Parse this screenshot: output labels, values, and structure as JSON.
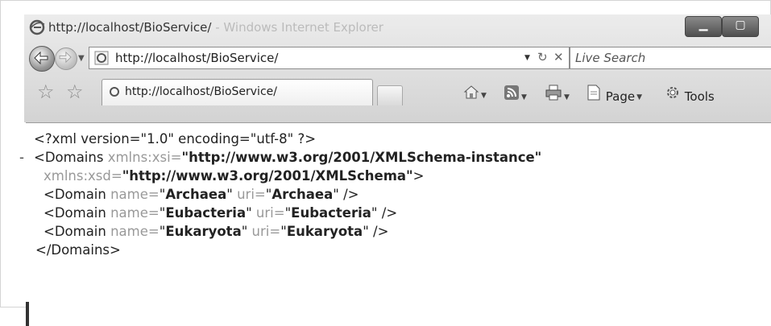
{
  "window": {
    "title_url": "http://localhost/BioService/",
    "title_app": " - Windows Internet Explorer",
    "minimize_glyph": "▁",
    "maximize_glyph": "▢",
    "icon": "ie-icon"
  },
  "navbar": {
    "back_icon": "back-arrow-icon",
    "forward_icon": "forward-arrow-icon",
    "address": "http://localhost/BioService/",
    "search_placeholder": "Live Search",
    "refresh_glyph": "↻",
    "stop_glyph": "✕"
  },
  "tabbar": {
    "tab_label": "http://localhost/BioService/",
    "tools": [
      {
        "label": "",
        "icon": "home-icon"
      },
      {
        "label": "",
        "icon": "rss-feed-icon"
      },
      {
        "label": "",
        "icon": "print-icon"
      },
      {
        "label": "Page",
        "icon": "page-icon"
      },
      {
        "label": "Tools",
        "icon": "gear-icon"
      }
    ]
  },
  "xml": {
    "decl": "<?xml version=\"1.0\" encoding=\"utf-8\" ?>",
    "minus": "-",
    "domains_open": "<Domains",
    "xsi_attr": " xmlns:xsi=",
    "xsi_val": "\"http://www.w3.org/2001/XMLSchema-instance\"",
    "xsd_attr": "xmlns:xsd=",
    "xsd_val": "\"http://www.w3.org/2001/XMLSchema\"",
    "gt": ">",
    "domains": [
      {
        "name": "Archaea",
        "uri": "Archaea"
      },
      {
        "name": "Eubacteria",
        "uri": "Eubacteria"
      },
      {
        "name": "Eukaryota",
        "uri": "Eukaryota"
      }
    ],
    "domain_open": "<Domain",
    "name_attr": " name=",
    "uri_attr": " uri=",
    "self_close": " />",
    "domains_close": "</Domains>"
  }
}
